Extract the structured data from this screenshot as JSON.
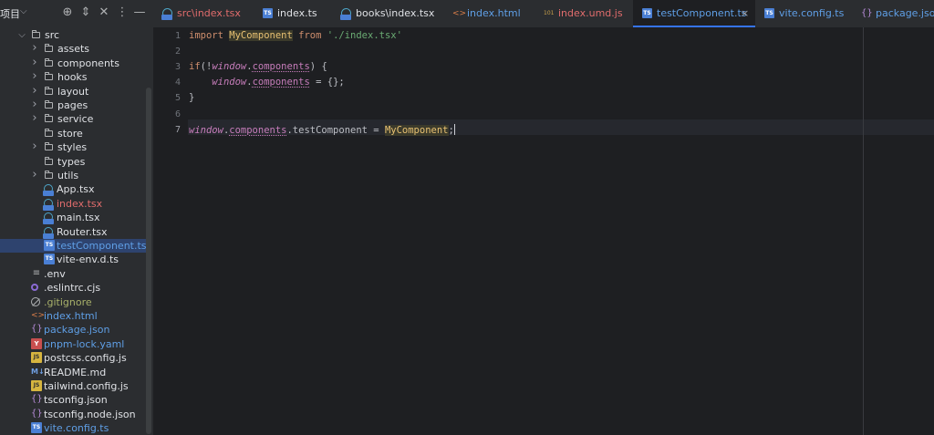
{
  "sidebar": {
    "title": "项目",
    "tree": [
      {
        "label": "src",
        "type": "folder",
        "expanded": true,
        "depth": 1,
        "color": "default"
      },
      {
        "label": "assets",
        "type": "folder",
        "expanded": false,
        "depth": 2,
        "color": "default"
      },
      {
        "label": "components",
        "type": "folder",
        "expanded": false,
        "depth": 2,
        "color": "default"
      },
      {
        "label": "hooks",
        "type": "folder",
        "expanded": false,
        "depth": 2,
        "color": "default"
      },
      {
        "label": "layout",
        "type": "folder",
        "expanded": false,
        "depth": 2,
        "color": "default"
      },
      {
        "label": "pages",
        "type": "folder",
        "expanded": false,
        "depth": 2,
        "color": "default"
      },
      {
        "label": "service",
        "type": "folder",
        "expanded": false,
        "depth": 2,
        "color": "default"
      },
      {
        "label": "store",
        "type": "folder",
        "expanded": null,
        "depth": 2,
        "color": "default"
      },
      {
        "label": "styles",
        "type": "folder",
        "expanded": false,
        "depth": 2,
        "color": "default"
      },
      {
        "label": "types",
        "type": "folder",
        "expanded": null,
        "depth": 2,
        "color": "default"
      },
      {
        "label": "utils",
        "type": "folder",
        "expanded": false,
        "depth": 2,
        "color": "default"
      },
      {
        "label": "App.tsx",
        "type": "tsx",
        "depth": 2,
        "color": "default"
      },
      {
        "label": "index.tsx",
        "type": "tsx",
        "depth": 2,
        "color": "red"
      },
      {
        "label": "main.tsx",
        "type": "tsx",
        "depth": 2,
        "color": "default"
      },
      {
        "label": "Router.tsx",
        "type": "tsx",
        "depth": 2,
        "color": "default"
      },
      {
        "label": "testComponent.ts",
        "type": "ts",
        "depth": 2,
        "color": "blue",
        "selected": true
      },
      {
        "label": "vite-env.d.ts",
        "type": "ts",
        "depth": 2,
        "color": "default"
      },
      {
        "label": ".env",
        "type": "env",
        "depth": 1,
        "color": "default"
      },
      {
        "label": ".eslintrc.cjs",
        "type": "eslint",
        "depth": 1,
        "color": "default"
      },
      {
        "label": ".gitignore",
        "type": "git",
        "depth": 1,
        "color": "olive"
      },
      {
        "label": "index.html",
        "type": "html",
        "depth": 1,
        "color": "blue"
      },
      {
        "label": "package.json",
        "type": "json",
        "depth": 1,
        "color": "blue"
      },
      {
        "label": "pnpm-lock.yaml",
        "type": "yaml",
        "depth": 1,
        "color": "blue"
      },
      {
        "label": "postcss.config.js",
        "type": "js",
        "depth": 1,
        "color": "default"
      },
      {
        "label": "README.md",
        "type": "md",
        "depth": 1,
        "color": "default"
      },
      {
        "label": "tailwind.config.js",
        "type": "js",
        "depth": 1,
        "color": "default"
      },
      {
        "label": "tsconfig.json",
        "type": "json",
        "depth": 1,
        "color": "default"
      },
      {
        "label": "tsconfig.node.json",
        "type": "json",
        "depth": 1,
        "color": "default"
      },
      {
        "label": "vite.config.ts",
        "type": "ts",
        "depth": 1,
        "color": "blue"
      }
    ]
  },
  "tabs": [
    {
      "label": "src\\index.tsx",
      "icon": "tsx",
      "color": "red"
    },
    {
      "label": "index.ts",
      "icon": "ts",
      "color": "default"
    },
    {
      "label": "books\\index.tsx",
      "icon": "tsx",
      "color": "default"
    },
    {
      "label": "index.html",
      "icon": "html",
      "color": "blue"
    },
    {
      "label": "index.umd.js",
      "icon": "binary",
      "color": "red"
    },
    {
      "label": "testComponent.ts",
      "icon": "ts",
      "color": "blue",
      "active": true
    },
    {
      "label": "vite.config.ts",
      "icon": "ts",
      "color": "blue"
    },
    {
      "label": "package.json",
      "icon": "json",
      "color": "blue"
    }
  ],
  "editor": {
    "line_numbers": [
      "1",
      "2",
      "3",
      "4",
      "5",
      "6",
      "7"
    ],
    "current_line": "7",
    "lines": [
      [
        {
          "t": "import ",
          "c": "kw"
        },
        {
          "t": "MyComponent",
          "c": "cls hl"
        },
        {
          "t": " from ",
          "c": "kw"
        },
        {
          "t": "'./index.tsx'",
          "c": "str"
        }
      ],
      [],
      [
        {
          "t": "if",
          "c": "kw"
        },
        {
          "t": "(!",
          "c": "plain"
        },
        {
          "t": "window",
          "c": "glb"
        },
        {
          "t": ".",
          "c": "plain"
        },
        {
          "t": "components",
          "c": "prop"
        },
        {
          "t": ") {",
          "c": "plain"
        }
      ],
      [
        {
          "t": "    ",
          "c": "plain"
        },
        {
          "t": "window",
          "c": "glb"
        },
        {
          "t": ".",
          "c": "plain"
        },
        {
          "t": "components",
          "c": "prop"
        },
        {
          "t": " = {};",
          "c": "plain"
        }
      ],
      [
        {
          "t": "}",
          "c": "plain"
        }
      ],
      [],
      [
        {
          "t": "window",
          "c": "glb"
        },
        {
          "t": ".",
          "c": "plain"
        },
        {
          "t": "components",
          "c": "prop"
        },
        {
          "t": ".testComponent = ",
          "c": "plain"
        },
        {
          "t": "MyComponent",
          "c": "cls hl"
        },
        {
          "t": ";",
          "c": "plain"
        }
      ]
    ]
  },
  "colors": {
    "accent": "#3574f0",
    "selection": "#2e436e",
    "vcs_modified": "#5f9fe6",
    "vcs_error": "#e06c6c",
    "vcs_ignored": "#a8b06a"
  }
}
